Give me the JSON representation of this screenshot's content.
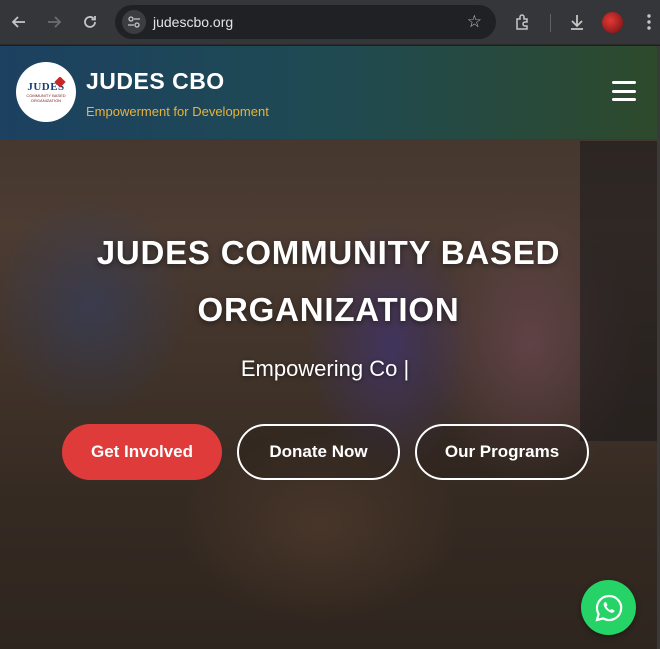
{
  "browser": {
    "url": "judescbo.org",
    "icons": [
      "back-icon",
      "forward-icon",
      "reload-icon",
      "site-info-icon",
      "star-icon",
      "extensions-icon",
      "download-icon",
      "profile-avatar",
      "menu-icon"
    ]
  },
  "site": {
    "logo": {
      "text_main": "JUDES",
      "text_sub": "COMMUNITY BASED ORGANIZATION"
    },
    "brand_name": "JUDES CBO",
    "tagline": "Empowerment for Development",
    "hero": {
      "title_line1": "JUDES COMMUNITY BASED",
      "title_line2": "ORGANIZATION",
      "subtitle": "Empowering Co |"
    },
    "buttons": {
      "get_involved": "Get Involved",
      "donate_now": "Donate Now",
      "our_programs": "Our Programs"
    },
    "colors": {
      "accent_red": "#e03b3b",
      "tagline_gold": "#e8b33a",
      "whatsapp_green": "#25d366",
      "header_blue": "#1c4161",
      "header_green": "#2e4a2c"
    }
  }
}
